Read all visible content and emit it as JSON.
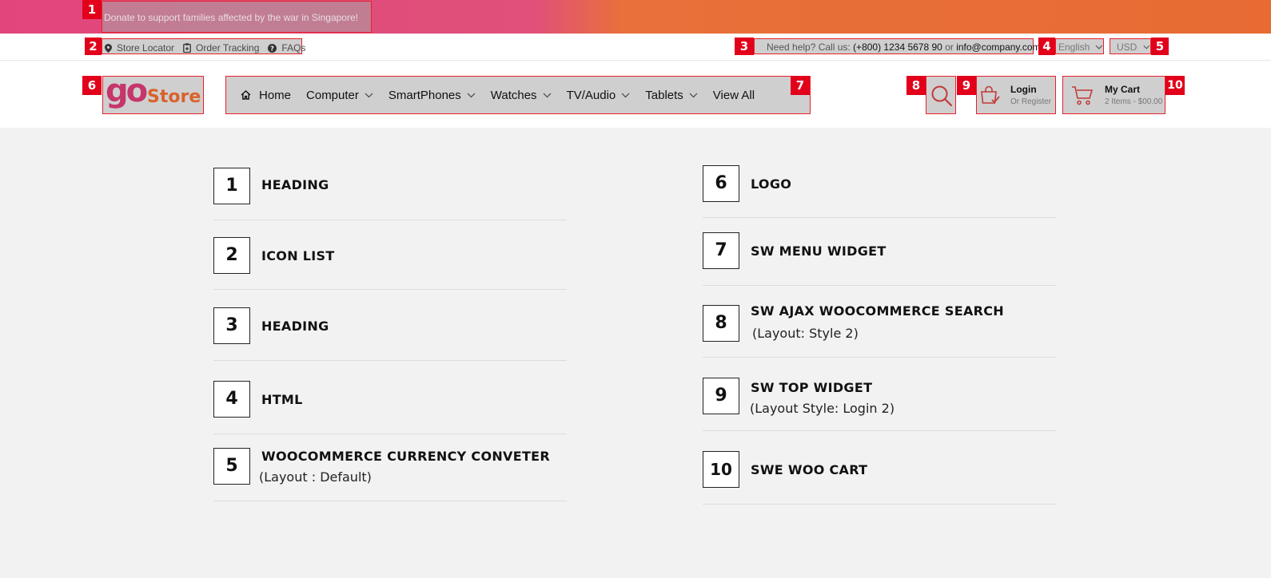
{
  "topbar": {
    "donate_text": "Donate to support families affected by the war in Singapore!"
  },
  "iconlist": [
    {
      "label": "Store Locator",
      "icon": "map-pin-icon"
    },
    {
      "label": "Order Tracking",
      "icon": "clipboard-icon"
    },
    {
      "label": "FAQs",
      "icon": "question-circle-icon"
    }
  ],
  "help": {
    "prefix": "Need help? Call us:",
    "phone": "(+800) 1234 5678 90",
    "or": "or",
    "email": "info@company.com"
  },
  "language": {
    "selected": "English"
  },
  "currency": {
    "selected": "USD"
  },
  "logo": {
    "part1": "go",
    "part2": "Store"
  },
  "menu": [
    {
      "label": "Home",
      "icon": "home-icon",
      "dropdown": false
    },
    {
      "label": "Computer",
      "dropdown": true
    },
    {
      "label": "SmartPhones",
      "dropdown": true
    },
    {
      "label": "Watches",
      "dropdown": true
    },
    {
      "label": "TV/Audio",
      "dropdown": true
    },
    {
      "label": "Tablets",
      "dropdown": true
    },
    {
      "label": "View All",
      "dropdown": false
    }
  ],
  "account": {
    "title": "Login",
    "subtitle": "Or Register"
  },
  "cart": {
    "title": "My Cart",
    "subtitle": "2 Items - $00.00"
  },
  "badges": [
    "1",
    "2",
    "3",
    "4",
    "5",
    "6",
    "7",
    "8",
    "9",
    "10"
  ],
  "legend_left": [
    {
      "num": "1",
      "title": "HEADING",
      "sub": ""
    },
    {
      "num": "2",
      "title": "ICON LIST",
      "sub": ""
    },
    {
      "num": "3",
      "title": "HEADING",
      "sub": ""
    },
    {
      "num": "4",
      "title": "HTML",
      "sub": ""
    },
    {
      "num": "5",
      "title": "WOOCOMMERCE CURRENCY CONVETER",
      "sub": "(Layout : Default)"
    }
  ],
  "legend_right": [
    {
      "num": "6",
      "title": "LOGO",
      "sub": ""
    },
    {
      "num": "7",
      "title": "SW MENU WIDGET",
      "sub": ""
    },
    {
      "num": "8",
      "title": "SW AJAX WOOCOMMERCE SEARCH",
      "sub": "(Layout: Style 2)"
    },
    {
      "num": "9",
      "title": "SW TOP WIDGET",
      "sub": "(Layout Style: Login 2)"
    },
    {
      "num": "10",
      "title": "SWE WOO CART",
      "sub": ""
    }
  ],
  "colors": {
    "accent": "#e2001a",
    "brand_pink": "#c6366b",
    "brand_orange": "#d9622b"
  }
}
